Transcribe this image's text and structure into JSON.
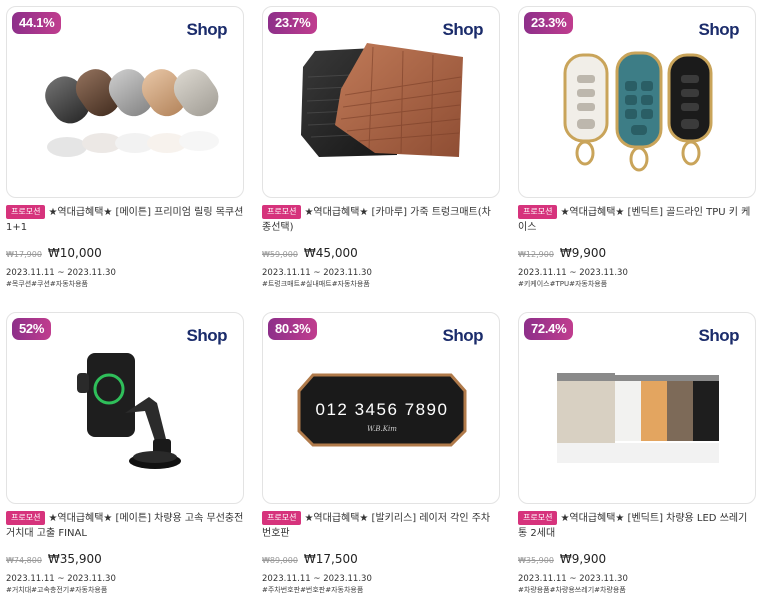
{
  "brand_logo": "Shop",
  "promo_label": "프로모션",
  "products": [
    {
      "discount": "44.1%",
      "title": "★역대급혜택★ [메이튼] 프리미엄 릴링 목쿠션 1+1",
      "original_price": "₩17,900",
      "sale_price": "₩10,000",
      "dates": "2023.11.11 ~ 2023.11.30",
      "tags": "#목쿠션#쿠션#자동차용품",
      "image": "neck-cushion-image"
    },
    {
      "discount": "23.7%",
      "title": "★역대급혜택★ [카마루] 가죽 트렁크매트(차종선택)",
      "original_price": "₩59,000",
      "sale_price": "₩45,000",
      "dates": "2023.11.11 ~ 2023.11.30",
      "tags": "#트렁크매트#실내매트#자동차용품",
      "image": "trunk-mat-image"
    },
    {
      "discount": "23.3%",
      "title": "★역대급혜택★ [벤딕트] 골드라인 TPU 키 케이스",
      "original_price": "₩12,900",
      "sale_price": "₩9,900",
      "dates": "2023.11.11 ~ 2023.11.30",
      "tags": "#키케이스#TPU#자동차용품",
      "image": "key-case-image"
    },
    {
      "discount": "52%",
      "title": "★역대급혜택★ [메이튼] 차량용 고속 무선충전 거치대 고출 FINAL",
      "original_price": "₩74,800",
      "sale_price": "₩35,900",
      "dates": "2023.11.11 ~ 2023.11.30",
      "tags": "#거치대#고속충전기#자동차용품",
      "image": "phone-mount-image"
    },
    {
      "discount": "80.3%",
      "title": "★역대급혜택★ [발키리스] 레이저 각인 주차 번호판",
      "original_price": "₩89,000",
      "sale_price": "₩17,500",
      "dates": "2023.11.11 ~ 2023.11.30",
      "tags": "#주차번호판#번호판#자동차용품",
      "image": "parking-plate-image",
      "plate_text": "012 3456 7890",
      "plate_signature": "W.B.Kim"
    },
    {
      "discount": "72.4%",
      "title": "★역대급혜택★ [벤딕트] 차량용 LED 쓰레기통 2세대",
      "original_price": "₩35,900",
      "sale_price": "₩9,900",
      "dates": "2023.11.11 ~ 2023.11.30",
      "tags": "#차량용품#차량용쓰레기#차량용품",
      "image": "trash-bin-image"
    }
  ]
}
